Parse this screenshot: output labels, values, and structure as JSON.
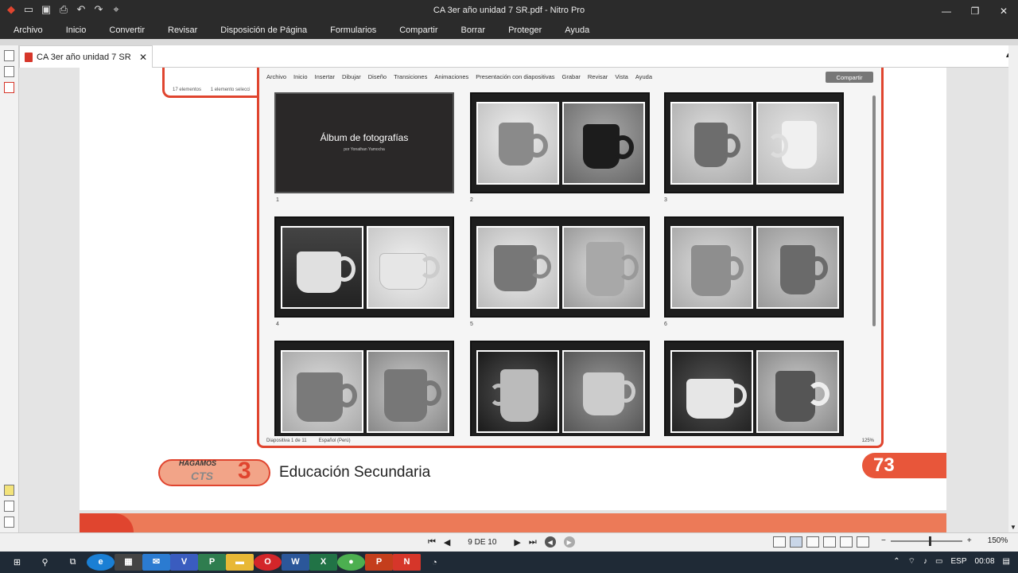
{
  "window": {
    "title": "CA 3er año unidad 7 SR.pdf - Nitro Pro",
    "controls": [
      "—",
      "❐",
      "✕"
    ]
  },
  "quick_access": [
    "open-icon",
    "save-icon",
    "print-icon",
    "undo-icon",
    "redo-icon",
    "select-icon"
  ],
  "menu": [
    "Archivo",
    "Inicio",
    "Convertir",
    "Revisar",
    "Disposición de Página",
    "Formularios",
    "Compartir",
    "Borrar",
    "Proteger",
    "Ayuda"
  ],
  "document_tab": {
    "label": "CA 3er año unidad 7 SR",
    "close": "✕"
  },
  "embedded": {
    "meta_left": "17 elementos",
    "meta_right": "1 elemento selecci",
    "menu": [
      "Archivo",
      "Inicio",
      "Insertar",
      "Dibujar",
      "Diseño",
      "Transiciones",
      "Animaciones",
      "Presentación con diapositivas",
      "Grabar",
      "Revisar",
      "Vista",
      "Ayuda"
    ],
    "share": "Compartir",
    "album_title": "Álbum de fotografías",
    "album_sub": "por Yonathan Yamocha",
    "slide_numbers": [
      "1",
      "2",
      "3",
      "4",
      "5",
      "6"
    ],
    "status_left": "Diapositiva 1 de 11",
    "status_lang": "Español (Perú)",
    "status_zoom": "125%"
  },
  "footer": {
    "hagamos": "HAGAMOS",
    "cts": "CTS",
    "number": "3",
    "education": "Educación Secundaria",
    "page_number": "73"
  },
  "statusbar": {
    "page_indicator": "9 DE 10",
    "zoom": "150%"
  },
  "taskbar": {
    "language": "ESP",
    "time": "00:08"
  },
  "colors": {
    "accent": "#e0452f",
    "titlebar": "#2b2b2b",
    "taskbar": "#1f2a36"
  }
}
